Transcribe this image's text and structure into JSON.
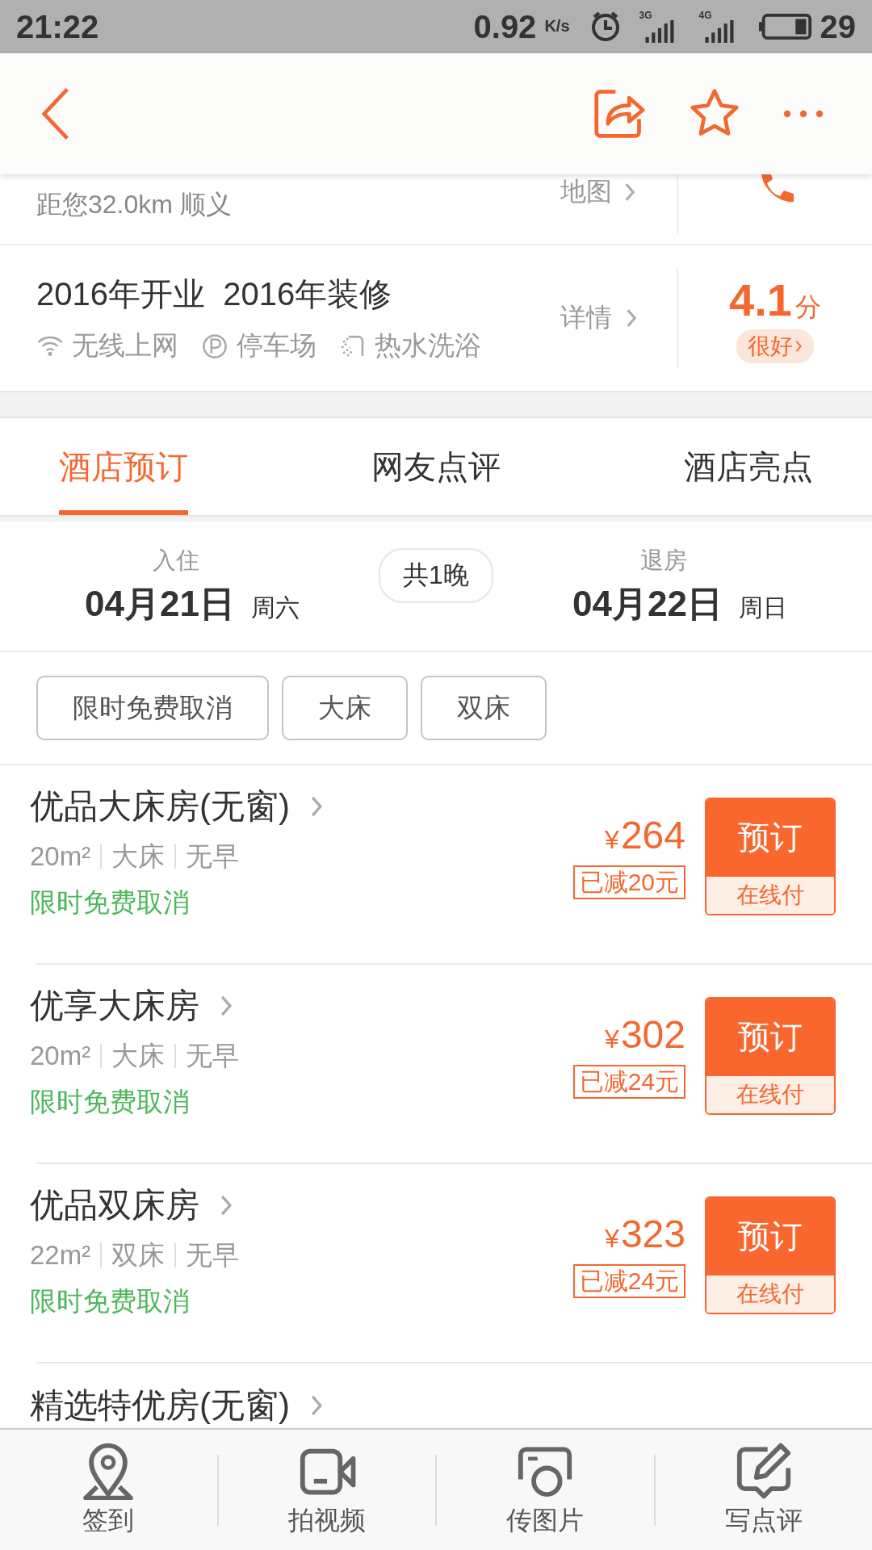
{
  "status_bar": {
    "time": "21:22",
    "net_speed": "0.92",
    "speed_unit": "K/s",
    "signals": [
      {
        "label": "3G"
      },
      {
        "label": "4G"
      }
    ],
    "battery": "29"
  },
  "location": {
    "distance": "距您32.0km 顺义",
    "map_link": "地图"
  },
  "info": {
    "years": "2016年开业  2016年装修",
    "amenities": [
      {
        "kind": "wifi",
        "label": "无线上网"
      },
      {
        "kind": "parking",
        "label": "停车场"
      },
      {
        "kind": "shower",
        "label": "热水洗浴"
      }
    ],
    "details_link": "详情",
    "score": "4.1",
    "score_unit": "分",
    "rating": "很好"
  },
  "tabs": [
    {
      "label": "酒店预订",
      "selected": true
    },
    {
      "label": "网友点评",
      "selected": false
    },
    {
      "label": "酒店亮点",
      "selected": false
    }
  ],
  "stay": {
    "checkin": {
      "label": "入住",
      "date": "04月21日",
      "weekday": "周六"
    },
    "nights": "共1晚",
    "checkout": {
      "label": "退房",
      "date": "04月22日",
      "weekday": "周日"
    }
  },
  "filters": [
    {
      "label": "限时免费取消",
      "selected": false
    },
    {
      "label": "大床",
      "selected": false
    },
    {
      "label": "双床",
      "selected": false
    }
  ],
  "rooms": [
    {
      "name": "优品大床房(无窗)",
      "area": "20m²",
      "bed": "大床",
      "breakfast": "无早",
      "cancel": "限时免费取消",
      "currency": "¥",
      "price": "264",
      "discount": "已减20元",
      "book": "预订",
      "pay": "在线付"
    },
    {
      "name": "优享大床房",
      "area": "20m²",
      "bed": "大床",
      "breakfast": "无早",
      "cancel": "限时免费取消",
      "currency": "¥",
      "price": "302",
      "discount": "已减24元",
      "book": "预订",
      "pay": "在线付"
    },
    {
      "name": "优品双床房",
      "area": "22m²",
      "bed": "双床",
      "breakfast": "无早",
      "cancel": "限时免费取消",
      "currency": "¥",
      "price": "323",
      "discount": "已减24元",
      "book": "预订",
      "pay": "在线付"
    },
    {
      "name": "精选特优房(无窗)"
    }
  ],
  "bottom_bar": [
    {
      "kind": "checkin",
      "label": "签到"
    },
    {
      "kind": "video",
      "label": "拍视频"
    },
    {
      "kind": "photo",
      "label": "传图片"
    },
    {
      "kind": "review",
      "label": "写点评"
    }
  ]
}
